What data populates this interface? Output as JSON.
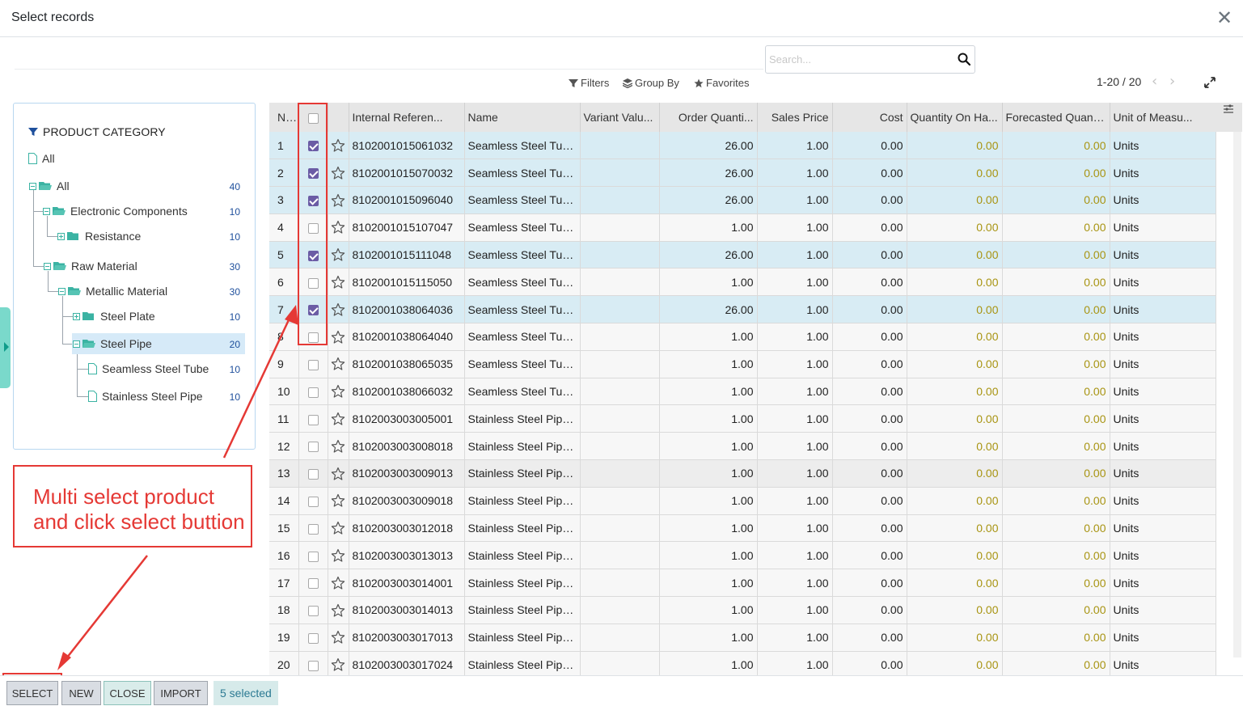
{
  "dialog": {
    "title": "Select records",
    "close_icon": "close-icon"
  },
  "search": {
    "placeholder": "Search...",
    "value": ""
  },
  "facets": {
    "filters": "Filters",
    "group_by": "Group By",
    "favorites": "Favorites"
  },
  "pager": {
    "text": "1-20 / 20"
  },
  "tree": {
    "header": "PRODUCT CATEGORY",
    "nodes": [
      {
        "label": "All",
        "count": ""
      },
      {
        "label": "All",
        "count": "40"
      },
      {
        "label": "Electronic Components",
        "count": "10"
      },
      {
        "label": "Resistance",
        "count": "10"
      },
      {
        "label": "Raw Material",
        "count": "30"
      },
      {
        "label": "Metallic Material",
        "count": "30"
      },
      {
        "label": "Steel Plate",
        "count": "10"
      },
      {
        "label": "Steel Pipe",
        "count": "20"
      },
      {
        "label": "Seamless Steel Tube",
        "count": "10"
      },
      {
        "label": "Stainless Steel Pipe",
        "count": "10"
      }
    ]
  },
  "table": {
    "columns": [
      "No.",
      "",
      "",
      "Internal Referen...",
      "Name",
      "Variant Valu...",
      "Order Quanti...",
      "Sales Price",
      "Cost",
      "Quantity On Ha...",
      "Forecasted Quanti...",
      "Unit of Measu..."
    ],
    "rows": [
      {
        "no": "1",
        "checked": true,
        "ref": "8102001015061032",
        "name": "Seamless Steel Tub...",
        "variant": "",
        "order_qty": "26.00",
        "price": "1.00",
        "cost": "0.00",
        "on_hand": "0.00",
        "forecast": "0.00",
        "uom": "Units"
      },
      {
        "no": "2",
        "checked": true,
        "ref": "8102001015070032",
        "name": "Seamless Steel Tub...",
        "variant": "",
        "order_qty": "26.00",
        "price": "1.00",
        "cost": "0.00",
        "on_hand": "0.00",
        "forecast": "0.00",
        "uom": "Units"
      },
      {
        "no": "3",
        "checked": true,
        "ref": "8102001015096040",
        "name": "Seamless Steel Tub...",
        "variant": "",
        "order_qty": "26.00",
        "price": "1.00",
        "cost": "0.00",
        "on_hand": "0.00",
        "forecast": "0.00",
        "uom": "Units"
      },
      {
        "no": "4",
        "checked": false,
        "ref": "8102001015107047",
        "name": "Seamless Steel Tub...",
        "variant": "",
        "order_qty": "1.00",
        "price": "1.00",
        "cost": "0.00",
        "on_hand": "0.00",
        "forecast": "0.00",
        "uom": "Units"
      },
      {
        "no": "5",
        "checked": true,
        "ref": "8102001015111048",
        "name": "Seamless Steel Tub...",
        "variant": "",
        "order_qty": "26.00",
        "price": "1.00",
        "cost": "0.00",
        "on_hand": "0.00",
        "forecast": "0.00",
        "uom": "Units"
      },
      {
        "no": "6",
        "checked": false,
        "ref": "8102001015115050",
        "name": "Seamless Steel Tub...",
        "variant": "",
        "order_qty": "1.00",
        "price": "1.00",
        "cost": "0.00",
        "on_hand": "0.00",
        "forecast": "0.00",
        "uom": "Units"
      },
      {
        "no": "7",
        "checked": true,
        "ref": "8102001038064036",
        "name": "Seamless Steel Tub...",
        "variant": "",
        "order_qty": "26.00",
        "price": "1.00",
        "cost": "0.00",
        "on_hand": "0.00",
        "forecast": "0.00",
        "uom": "Units"
      },
      {
        "no": "8",
        "checked": false,
        "ref": "8102001038064040",
        "name": "Seamless Steel Tub...",
        "variant": "",
        "order_qty": "1.00",
        "price": "1.00",
        "cost": "0.00",
        "on_hand": "0.00",
        "forecast": "0.00",
        "uom": "Units"
      },
      {
        "no": "9",
        "checked": false,
        "ref": "8102001038065035",
        "name": "Seamless Steel Tub...",
        "variant": "",
        "order_qty": "1.00",
        "price": "1.00",
        "cost": "0.00",
        "on_hand": "0.00",
        "forecast": "0.00",
        "uom": "Units"
      },
      {
        "no": "10",
        "checked": false,
        "ref": "8102001038066032",
        "name": "Seamless Steel Tub...",
        "variant": "",
        "order_qty": "1.00",
        "price": "1.00",
        "cost": "0.00",
        "on_hand": "0.00",
        "forecast": "0.00",
        "uom": "Units"
      },
      {
        "no": "11",
        "checked": false,
        "ref": "8102003003005001",
        "name": "Stainless Steel Pipe...",
        "variant": "",
        "order_qty": "1.00",
        "price": "1.00",
        "cost": "0.00",
        "on_hand": "0.00",
        "forecast": "0.00",
        "uom": "Units"
      },
      {
        "no": "12",
        "checked": false,
        "ref": "8102003003008018",
        "name": "Stainless Steel Pipe...",
        "variant": "",
        "order_qty": "1.00",
        "price": "1.00",
        "cost": "0.00",
        "on_hand": "0.00",
        "forecast": "0.00",
        "uom": "Units"
      },
      {
        "no": "13",
        "checked": false,
        "ref": "8102003003009013",
        "name": "Stainless Steel Pipe...",
        "variant": "",
        "order_qty": "1.00",
        "price": "1.00",
        "cost": "0.00",
        "on_hand": "0.00",
        "forecast": "0.00",
        "uom": "Units"
      },
      {
        "no": "14",
        "checked": false,
        "ref": "8102003003009018",
        "name": "Stainless Steel Pipe...",
        "variant": "",
        "order_qty": "1.00",
        "price": "1.00",
        "cost": "0.00",
        "on_hand": "0.00",
        "forecast": "0.00",
        "uom": "Units"
      },
      {
        "no": "15",
        "checked": false,
        "ref": "8102003003012018",
        "name": "Stainless Steel Pipe...",
        "variant": "",
        "order_qty": "1.00",
        "price": "1.00",
        "cost": "0.00",
        "on_hand": "0.00",
        "forecast": "0.00",
        "uom": "Units"
      },
      {
        "no": "16",
        "checked": false,
        "ref": "8102003003013013",
        "name": "Stainless Steel Pipe...",
        "variant": "",
        "order_qty": "1.00",
        "price": "1.00",
        "cost": "0.00",
        "on_hand": "0.00",
        "forecast": "0.00",
        "uom": "Units"
      },
      {
        "no": "17",
        "checked": false,
        "ref": "8102003003014001",
        "name": "Stainless Steel Pipe...",
        "variant": "",
        "order_qty": "1.00",
        "price": "1.00",
        "cost": "0.00",
        "on_hand": "0.00",
        "forecast": "0.00",
        "uom": "Units"
      },
      {
        "no": "18",
        "checked": false,
        "ref": "8102003003014013",
        "name": "Stainless Steel Pipe...",
        "variant": "",
        "order_qty": "1.00",
        "price": "1.00",
        "cost": "0.00",
        "on_hand": "0.00",
        "forecast": "0.00",
        "uom": "Units"
      },
      {
        "no": "19",
        "checked": false,
        "ref": "8102003003017013",
        "name": "Stainless Steel Pipe...",
        "variant": "",
        "order_qty": "1.00",
        "price": "1.00",
        "cost": "0.00",
        "on_hand": "0.00",
        "forecast": "0.00",
        "uom": "Units"
      },
      {
        "no": "20",
        "checked": false,
        "ref": "8102003003017024",
        "name": "Stainless Steel Pipe...",
        "variant": "",
        "order_qty": "1.00",
        "price": "1.00",
        "cost": "0.00",
        "on_hand": "0.00",
        "forecast": "0.00",
        "uom": "Units"
      }
    ]
  },
  "annotation": {
    "line1": "Multi select product",
    "line2": "and click select buttion"
  },
  "footer": {
    "select": "SELECT",
    "new": "NEW",
    "close": "CLOSE",
    "import": "IMPORT",
    "selected": "5 selected"
  },
  "colors": {
    "accent_checkbox": "#6b5ca5",
    "selected_row": "#d8ecf4",
    "qty_yellow": "#a89412",
    "annotation_red": "#e53935",
    "teal": "#3bb3a3"
  }
}
